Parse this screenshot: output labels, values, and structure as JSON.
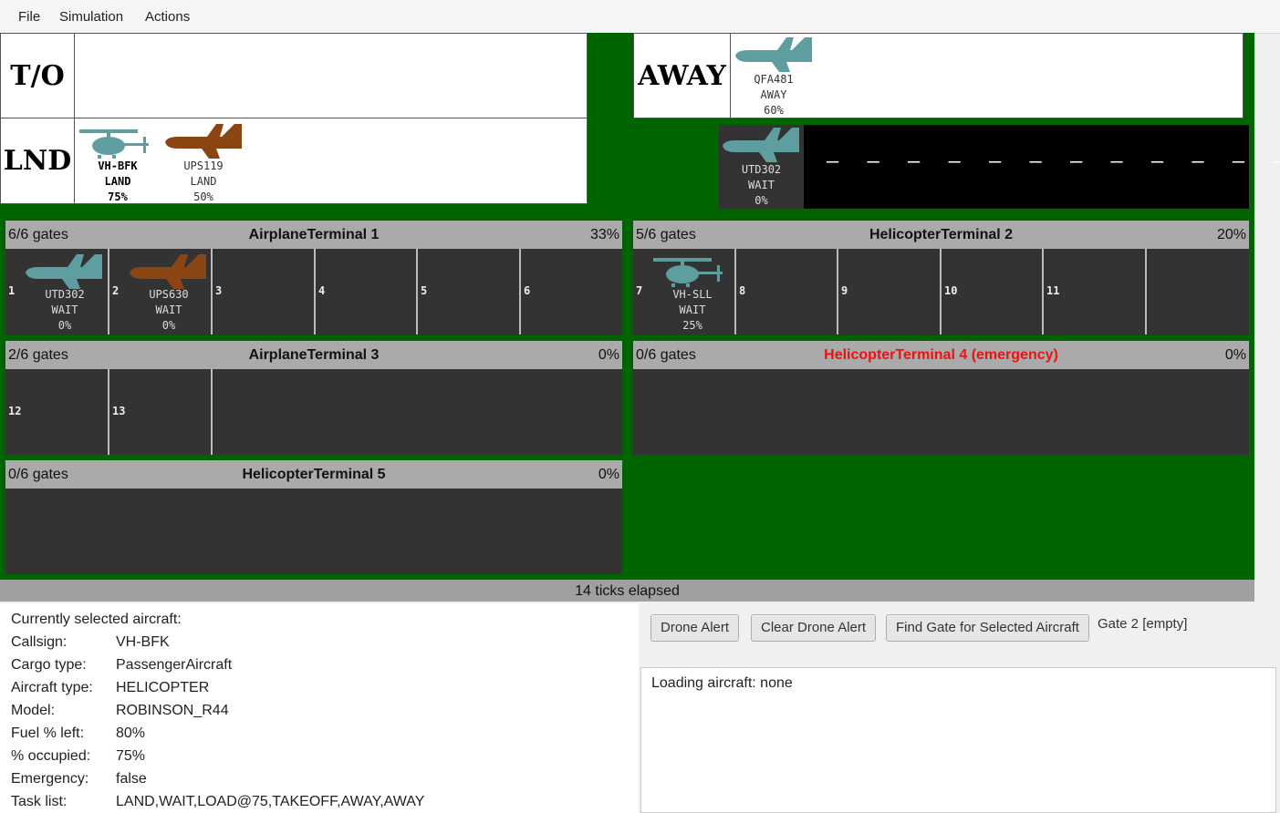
{
  "menu": {
    "file": "File",
    "simulation": "Simulation",
    "actions": "Actions"
  },
  "queues": {
    "takeoff": {
      "label": "T/O"
    },
    "land": {
      "label": "LND",
      "aircraft": [
        {
          "callsign": "VH-BFK",
          "task": "LAND",
          "pct": "75%",
          "kind": "helicopter",
          "color": "#5f9ea0"
        },
        {
          "callsign": "UPS119",
          "task": "LAND",
          "pct": "50%",
          "kind": "airplane",
          "color": "#8b4513"
        }
      ]
    },
    "away": {
      "label": "AWAY",
      "aircraft": [
        {
          "callsign": "QFA481",
          "task": "AWAY",
          "pct": "60%",
          "kind": "airplane",
          "color": "#5f9ea0"
        }
      ]
    },
    "runway": {
      "callsign": "UTD302",
      "task": "WAIT",
      "pct": "0%",
      "kind": "airplane",
      "color": "#5f9ea0"
    }
  },
  "terminals": {
    "t1": {
      "gates": "6/6 gates",
      "name": "AirplaneTerminal 1",
      "pct": "33%",
      "gate_numbers": [
        "1",
        "2",
        "3",
        "4",
        "5",
        "6"
      ],
      "g1": {
        "callsign": "UTD302",
        "task": "WAIT",
        "pct": "0%",
        "color": "#5f9ea0"
      },
      "g2": {
        "callsign": "UPS630",
        "task": "WAIT",
        "pct": "0%",
        "color": "#8b4513"
      }
    },
    "t2": {
      "gates": "5/6 gates",
      "name": "HelicopterTerminal 2",
      "pct": "20%",
      "gate_numbers": [
        "7",
        "8",
        "9",
        "10",
        "11"
      ],
      "g7": {
        "callsign": "VH-SLL",
        "task": "WAIT",
        "pct": "25%",
        "color": "#5f9ea0"
      }
    },
    "t3": {
      "gates": "2/6 gates",
      "name": "AirplaneTerminal 3",
      "pct": "0%",
      "gate_numbers": [
        "12",
        "13"
      ]
    },
    "t4": {
      "gates": "0/6 gates",
      "name": "HelicopterTerminal 4 (emergency)",
      "pct": "0%",
      "name_color": "#ee1111"
    },
    "t5": {
      "gates": "0/6 gates",
      "name": "HelicopterTerminal 5",
      "pct": "0%"
    }
  },
  "status": {
    "ticks": "14 ticks elapsed"
  },
  "selected": {
    "heading": "Currently selected aircraft:",
    "rows": [
      {
        "key": "Callsign:",
        "value": "VH-BFK"
      },
      {
        "key": "Cargo type:",
        "value": "PassengerAircraft"
      },
      {
        "key": "Aircraft type:",
        "value": "HELICOPTER"
      },
      {
        "key": "Model:",
        "value": "ROBINSON_R44"
      },
      {
        "key": "Fuel % left:",
        "value": "80%"
      },
      {
        "key": "% occupied:",
        "value": "75%"
      },
      {
        "key": "Emergency:",
        "value": "false"
      },
      {
        "key": "Task list:",
        "value": "LAND,WAIT,LOAD@75,TAKEOFF,AWAY,AWAY"
      }
    ]
  },
  "controls": {
    "drone_alert": "Drone Alert",
    "clear_drone_alert": "Clear Drone Alert",
    "find_gate": "Find Gate for Selected Aircraft",
    "gate_result": "Gate 2 [empty]"
  },
  "loading": {
    "text": "Loading aircraft: none"
  },
  "icons": {
    "airplane": "airplane-icon",
    "helicopter": "helicopter-icon"
  }
}
